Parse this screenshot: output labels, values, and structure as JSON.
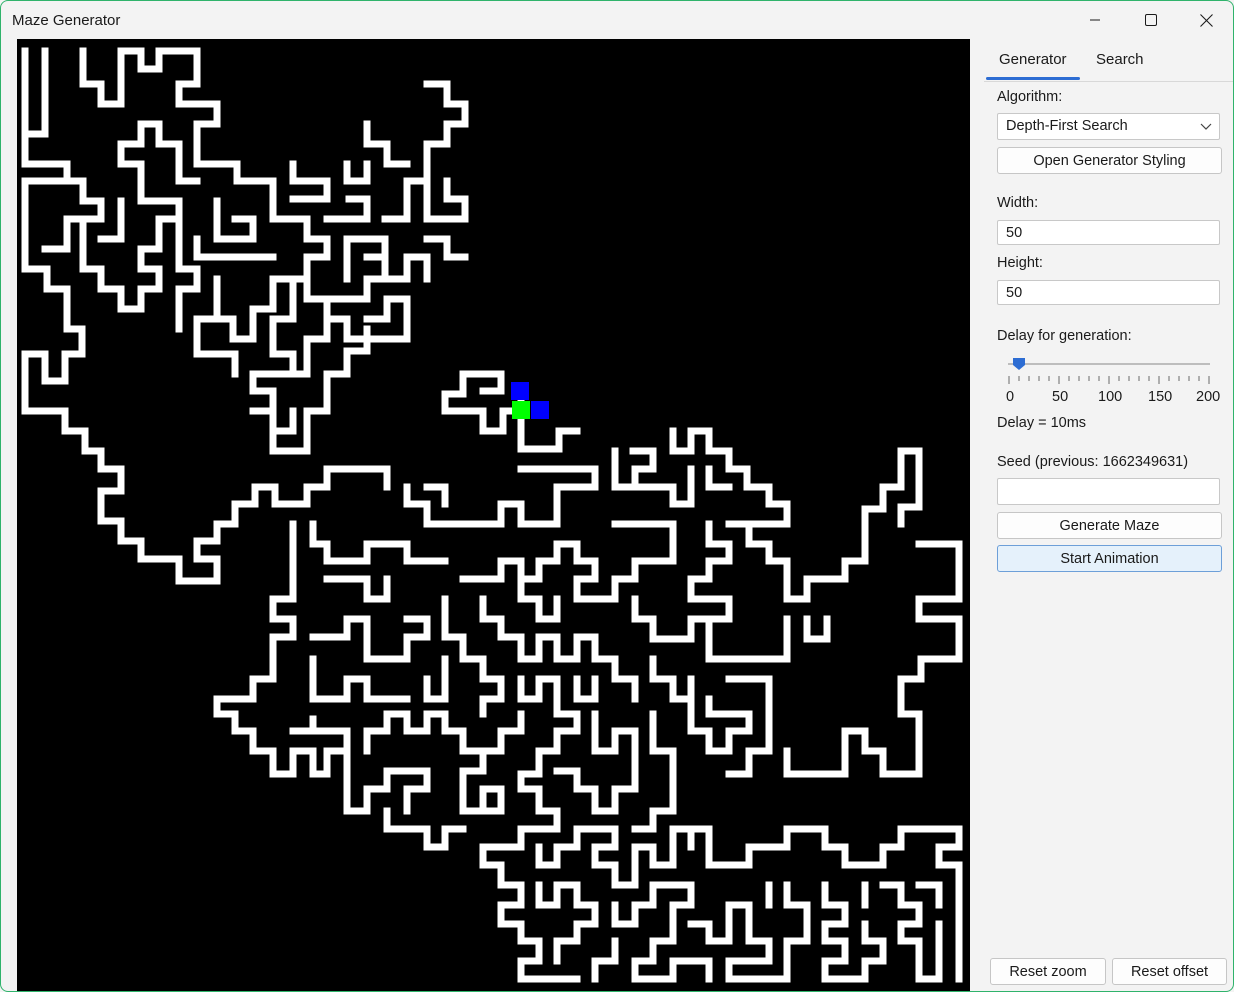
{
  "window": {
    "title": "Maze Generator"
  },
  "tabs": [
    {
      "label": "Generator",
      "selected": true
    },
    {
      "label": "Search",
      "selected": false
    }
  ],
  "generator": {
    "algorithm_label": "Algorithm:",
    "algorithm_value": "Depth-First Search",
    "styling_button": "Open Generator Styling",
    "width_label": "Width:",
    "width_value": "50",
    "height_label": "Height:",
    "height_value": "50",
    "delay_label": "Delay for generation:",
    "delay_slider": {
      "min": 0,
      "max": 200,
      "value": 10,
      "tick_labels": [
        "0",
        "50",
        "100",
        "150",
        "200"
      ]
    },
    "delay_readout": "Delay = 10ms",
    "seed_label": "Seed (previous: 1662349631)",
    "seed_value": "",
    "generate_button": "Generate Maze",
    "animate_button": "Start Animation"
  },
  "footer": {
    "reset_zoom": "Reset zoom",
    "reset_offset": "Reset offset"
  },
  "maze": {
    "background_color": "#000000",
    "path_color": "#ffffff",
    "cursor_color": "#00ff00",
    "frontier_color": "#0000ff"
  },
  "icons": {
    "minimize": "minimize-icon",
    "maximize": "maximize-icon",
    "close": "close-icon",
    "dropdown": "chevron-down-icon"
  }
}
